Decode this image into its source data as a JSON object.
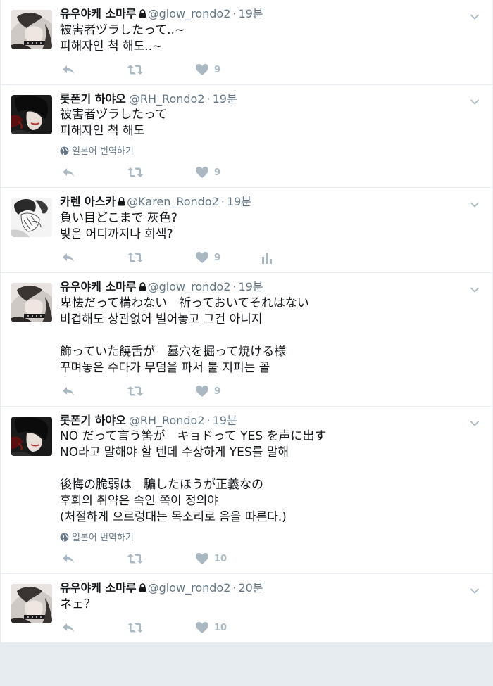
{
  "tweets": [
    {
      "name": "유우야케 소마루",
      "handle": "@glow_rondo2",
      "time": "19분",
      "locked": true,
      "lines": [
        "被害者ヅラしたって..~",
        "피해자인 척 해도..~"
      ],
      "translate": null,
      "likes": "9",
      "analytics": false,
      "avatar": "somaru"
    },
    {
      "name": "롯폰기 하야오",
      "handle": "@RH_Rondo2",
      "time": "19분",
      "locked": false,
      "lines": [
        "被害者ヅラしたって",
        "피해자인 척 해도"
      ],
      "translate": "일본어 번역하기",
      "likes": "9",
      "analytics": false,
      "avatar": "hayao"
    },
    {
      "name": "카렌 아스카",
      "handle": "@Karen_Rondo2",
      "time": "19분",
      "locked": true,
      "lines": [
        "負い目どこまで 灰色?",
        "빚은 어디까지나 회색?"
      ],
      "translate": null,
      "likes": "9",
      "analytics": true,
      "avatar": "karen"
    },
    {
      "name": "유우야케 소마루",
      "handle": "@glow_rondo2",
      "time": "19분",
      "locked": true,
      "lines": [
        "卑怯だって構わない　祈っておいてそれはない",
        "비겁해도 상관없어 빌어놓고 그건 아니지",
        "",
        "飾っていた饒舌が　墓穴を掘って焼ける様",
        "꾸며놓은 수다가 무덤을 파서 불 지피는 꼴"
      ],
      "translate": null,
      "likes": "9",
      "analytics": false,
      "avatar": "somaru"
    },
    {
      "name": "롯폰기 하야오",
      "handle": "@RH_Rondo2",
      "time": "19분",
      "locked": false,
      "lines": [
        "NO だって言う筈が　キョドって YES を声に出す",
        "NO라고 말해야 할 텐데 수상하게 YES를 말해",
        "",
        "後悔の脆弱は　騙したほうが正義なの",
        "후회의 취약은 속인 쪽이 정의야",
        "(처절하게 으르렁대는 목소리로 음을 따른다.)"
      ],
      "translate": "일본어 번역하기",
      "likes": "10",
      "analytics": false,
      "avatar": "hayao"
    },
    {
      "name": "유우야케 소마루",
      "handle": "@glow_rondo2",
      "time": "20분",
      "locked": true,
      "lines": [
        "ネェ？"
      ],
      "translate": null,
      "likes": "10",
      "analytics": false,
      "avatar": "somaru"
    }
  ],
  "colors": {
    "icon": "#aab8c2",
    "meta": "#657786",
    "text": "#14171a",
    "border": "#e6ecf0"
  },
  "dot": "·"
}
